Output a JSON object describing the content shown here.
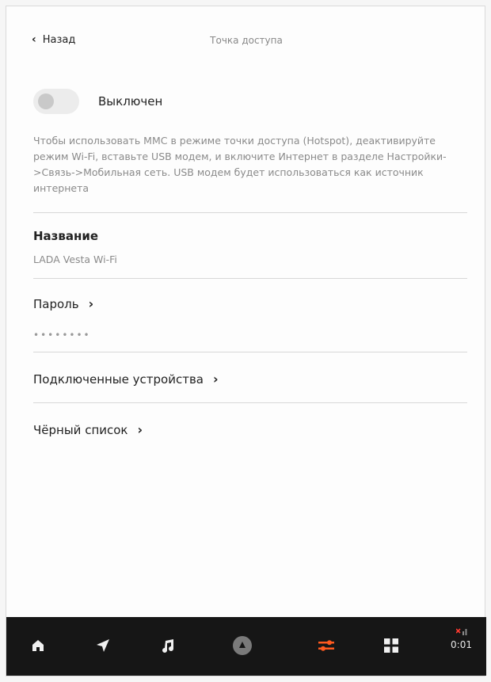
{
  "header": {
    "back_label": "Назад",
    "title": "Точка доступа"
  },
  "hotspot": {
    "toggle_state": "off",
    "toggle_label": "Выключен",
    "info_text": "Чтобы использовать ММС в режиме точки доступа (Hotspot), деактивируйте режим Wi-Fi, вставьте USB модем, и включите Интернет в разделе Настройки->Связь->Мобильная сеть. USB модем будет использоваться как источник интернета"
  },
  "name_section": {
    "label": "Название",
    "value": "LADA Vesta Wi-Fi"
  },
  "password_section": {
    "label": "Пароль",
    "masked_value": "••••••••"
  },
  "connected_devices": {
    "label": "Подключенные устройства"
  },
  "blacklist": {
    "label": "Чёрный список"
  },
  "bottom_nav": {
    "items": [
      {
        "icon": "home-icon",
        "active": false
      },
      {
        "icon": "navigation-icon",
        "active": false
      },
      {
        "icon": "music-icon",
        "active": false
      },
      {
        "icon": "voice-assistant-icon",
        "active": false
      },
      {
        "icon": "settings-sliders-icon",
        "active": true
      },
      {
        "icon": "apps-grid-icon",
        "active": false
      }
    ],
    "time": "0:01",
    "accent_color": "#ff5a1f"
  }
}
